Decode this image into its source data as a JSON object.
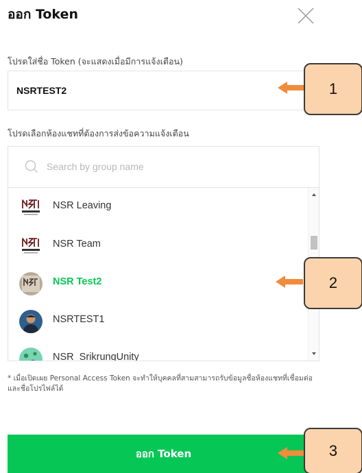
{
  "dialog": {
    "title": "ออก Token",
    "name_label": "โปรดใส่ชื่อ Token (จะแสดงเมื่อมีการแจ้งเตือน)",
    "name_value": "NSRTEST2",
    "chat_label": "โปรดเลือกห้องแชทที่ต้องการส่งข้อความแจ้งเตือน",
    "search_placeholder": "Search by group name",
    "chats": [
      {
        "name": "NSR Leaving",
        "avatar": "nsr-technology-logo",
        "selected": false
      },
      {
        "name": "NSR Team",
        "avatar": "nsr-technology-logo",
        "selected": false
      },
      {
        "name": "NSR Test2",
        "avatar": "nsr-logo-photo",
        "selected": true
      },
      {
        "name": "NSRTEST1",
        "avatar": "person-photo",
        "selected": false
      },
      {
        "name": "NSR_SrikrungUnity",
        "avatar": "green-clover-photo",
        "selected": false
      }
    ],
    "disclaimer": "* เมื่อเปิดเผย Personal Access Token จะทำให้บุคคลที่สามสามารถรับข้อมูลชื่อห้องแชทที่เชื่อมต่อและชื่อโปรไฟล์ได้",
    "issue_button": "ออก Token"
  },
  "annotations": [
    {
      "number": "1",
      "points_to": "name-input"
    },
    {
      "number": "2",
      "points_to": "chat-item-nsr-test2"
    },
    {
      "number": "3",
      "points_to": "issue-token-button"
    }
  ],
  "colors": {
    "accent_green": "#06c755",
    "callout_fill": "#fbd3ac",
    "arrow": "#f08c3c"
  }
}
